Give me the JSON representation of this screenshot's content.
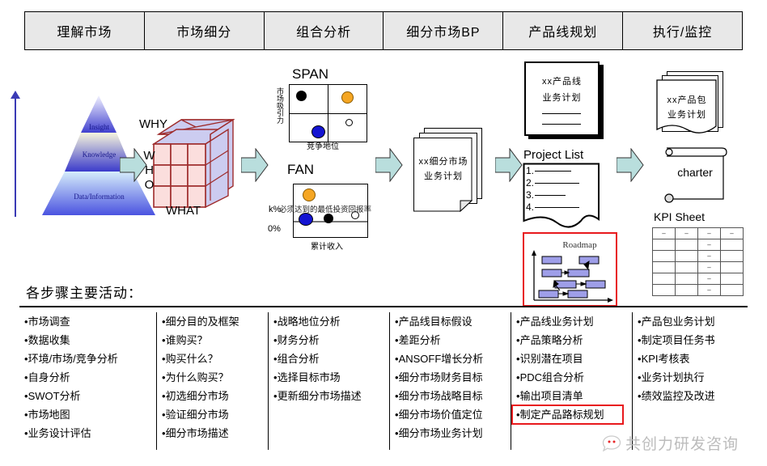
{
  "phases": [
    {
      "label": "理解市场"
    },
    {
      "label": "市场细分"
    },
    {
      "label": "组合分析"
    },
    {
      "label": "细分市场BP"
    },
    {
      "label": "产品线规划"
    },
    {
      "label": "执行/监控"
    }
  ],
  "pyramid": {
    "levels": [
      "Insight",
      "Knowledge",
      "Data/Information"
    ]
  },
  "cube": {
    "why": "WHY",
    "who": "WHO",
    "what": "WHAT"
  },
  "span_chart": {
    "title": "SPAN",
    "ylabel": "市场吸引力",
    "xlabel": "竞争地位"
  },
  "fan_chart": {
    "title": "FAN",
    "ylabel_top": "k%",
    "ylabel_bottom": "0%",
    "overlay": "必须达到的最低投资回报率",
    "xlabel": "累计收入"
  },
  "docs": {
    "segment_bp_line1": "xx细分市场",
    "segment_bp_line2": "业务计划",
    "product_line_bp_line1": "xx产品线",
    "product_line_bp_line2": "业务计划",
    "project_list_title": "Project List",
    "project_items": [
      "1.",
      "2.",
      "3.",
      "4."
    ],
    "roadmap_title": "Roadmap",
    "product_pack_line1": "xx产品包",
    "product_pack_line2": "业务计划",
    "charter": "charter",
    "kpi_sheet": "KPI Sheet"
  },
  "activities": {
    "title": "各步骤主要活动：",
    "columns": [
      {
        "items": [
          "市场调查",
          "数据收集",
          "环境/市场/竞争分析",
          "自身分析",
          "SWOT分析",
          "市场地图",
          "业务设计评估"
        ]
      },
      {
        "items": [
          "细分目的及框架",
          "谁购买？",
          "购买什么？",
          "为什么购买？",
          "初选细分市场",
          "验证细分市场",
          "细分市场描述"
        ]
      },
      {
        "items": [
          "战略地位分析",
          "财务分析",
          "组合分析",
          "选择目标市场",
          "更新细分市场描述"
        ]
      },
      {
        "items": [
          "产品线目标假设",
          "差距分析",
          "ANSOFF增长分析",
          "细分市场财务目标",
          "细分市场战略目标",
          "细分市场价值定位",
          "细分市场业务计划"
        ]
      },
      {
        "items": [
          "产品线业务计划",
          "产品策略分析",
          "识别潜在项目",
          "PDC组合分析",
          "输出项目清单",
          "制定产品路标规划"
        ],
        "highlight_index": 5
      },
      {
        "items": [
          "产品包业务计划",
          "制定项目任务书",
          "KPI考核表",
          "业务计划执行",
          "绩效监控及改进"
        ]
      }
    ]
  },
  "watermark": {
    "text": "共创力研发咨询",
    "icon": "chat-bubble-face-icon"
  },
  "colors": {
    "arrow_fill": "#b9dedd",
    "highlight": "#e8191c",
    "cube_front": "#fbdedd",
    "cube_side": "#ccccf0",
    "span_orange": "#f5a623",
    "span_blue": "#1414d2",
    "roadmap_node": "#9e9ee8",
    "header_bg": "#e8e8e8"
  }
}
